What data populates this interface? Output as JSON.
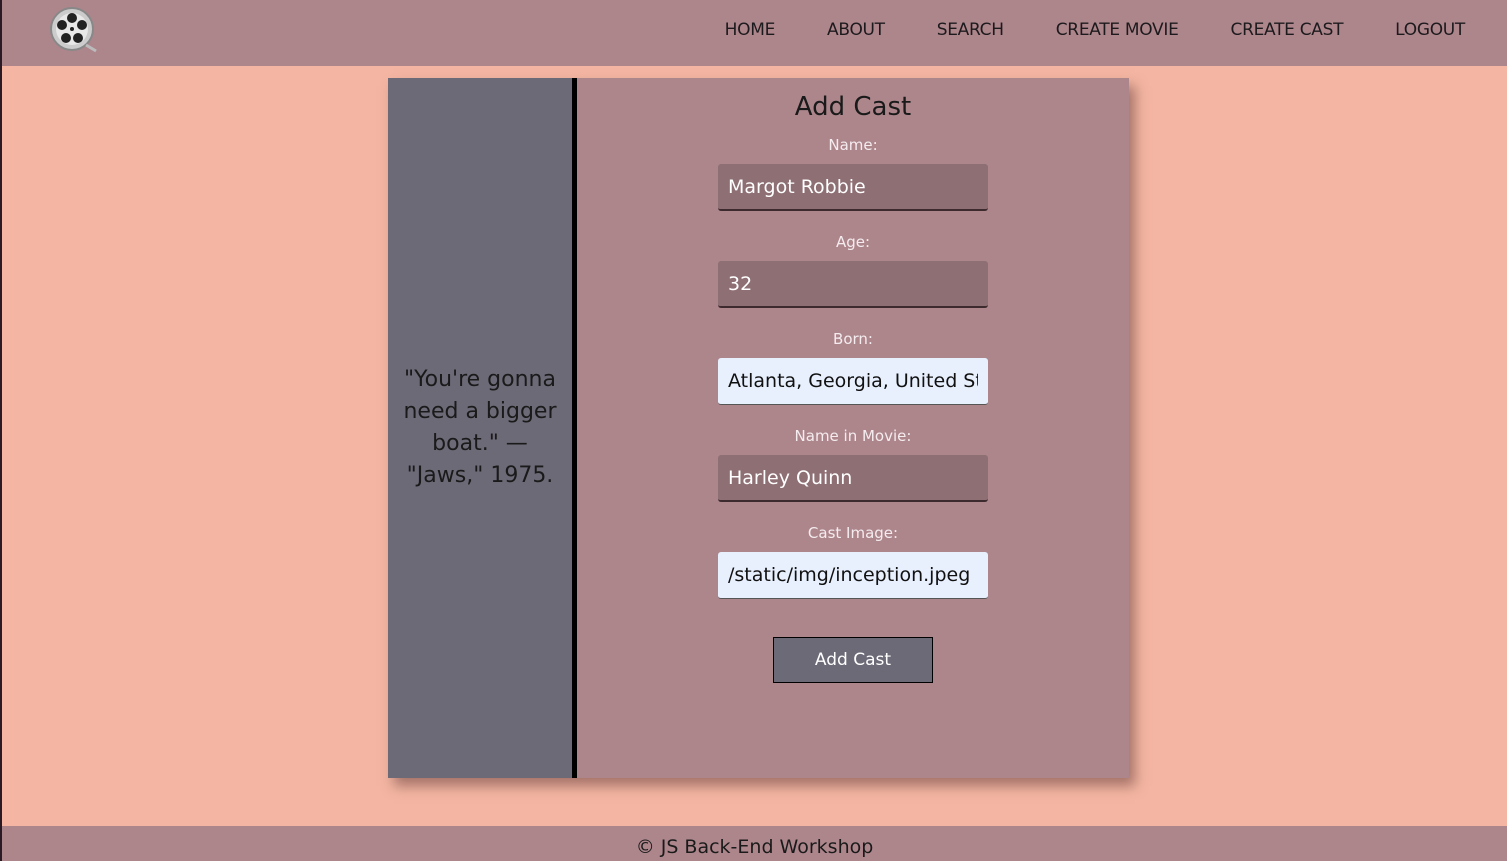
{
  "nav": {
    "logo": "film-reel-logo",
    "items": [
      "HOME",
      "ABOUT",
      "SEARCH",
      "CREATE MOVIE",
      "CREATE CAST",
      "LOGOUT"
    ]
  },
  "quote": "\"You're gonna need a bigger boat.\" — \"Jaws,\" 1975.",
  "form": {
    "title": "Add Cast",
    "name": {
      "label": "Name:",
      "value": "Margot Robbie"
    },
    "age": {
      "label": "Age:",
      "value": "32"
    },
    "born": {
      "label": "Born:",
      "value": "Atlanta, Georgia, United States"
    },
    "name_in_movie": {
      "label": "Name in Movie:",
      "value": "Harley Quinn"
    },
    "cast_image": {
      "label": "Cast Image:",
      "value": "/static/img/inception.jpeg"
    },
    "submit": "Add Cast"
  },
  "footer": "© JS Back-End Workshop"
}
